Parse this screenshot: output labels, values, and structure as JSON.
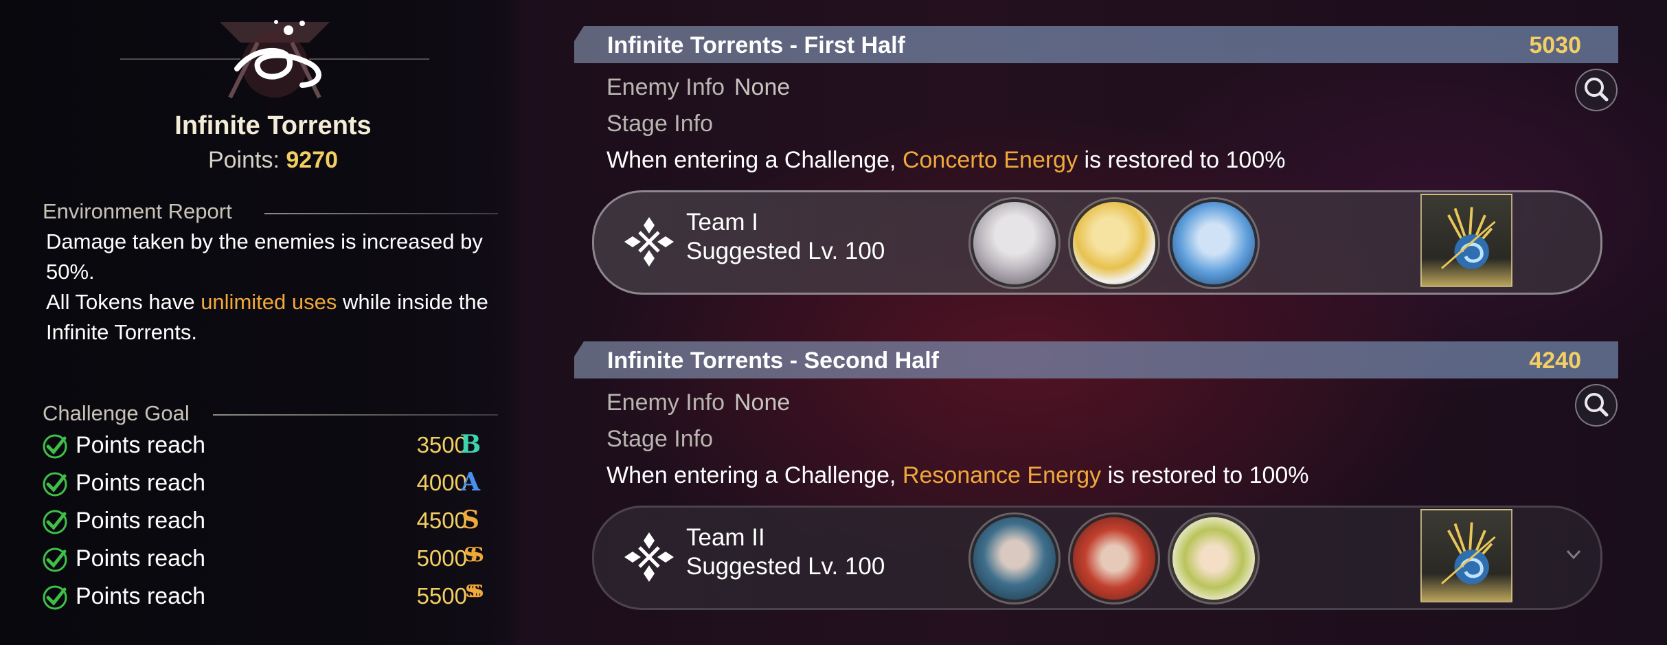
{
  "left": {
    "stage_name": "Infinite Torrents",
    "points_label": "Points:",
    "points_value": "9270",
    "environment": {
      "title": "Environment Report",
      "line1": "Damage taken by the enemies is increased by 50%.",
      "line2_pre": "All Tokens have ",
      "line2_highlight": "unlimited uses",
      "line2_post": " while inside the Infinite Torrents."
    },
    "goals": {
      "title": "Challenge Goal",
      "items": [
        {
          "label": "Points reach",
          "value": "3500",
          "grade": "B",
          "color": "#3fd3b0"
        },
        {
          "label": "Points reach",
          "value": "4000",
          "grade": "A",
          "color": "#4a8ff0"
        },
        {
          "label": "Points reach",
          "value": "4500",
          "grade": "S",
          "color": "#f0a93a"
        },
        {
          "label": "Points reach",
          "value": "5000",
          "grade": "SS",
          "color": "#f0a93a"
        },
        {
          "label": "Points reach",
          "value": "5500",
          "grade": "SSS",
          "color": "#f0a93a"
        }
      ]
    }
  },
  "stages": [
    {
      "title": "Infinite Torrents - First Half",
      "score": "5030",
      "enemy_label": "Enemy Info",
      "enemy_value": "None",
      "stage_info_label": "Stage Info",
      "desc_pre": "When entering a Challenge, ",
      "desc_highlight": "Concerto Energy",
      "desc_post": " is restored to 100%",
      "team_name": "Team I",
      "team_level": "Suggested Lv. 100"
    },
    {
      "title": "Infinite Torrents - Second Half",
      "score": "4240",
      "enemy_label": "Enemy Info",
      "enemy_value": "None",
      "stage_info_label": "Stage Info",
      "desc_pre": "When entering a Challenge, ",
      "desc_highlight": "Resonance Energy",
      "desc_post": " is restored to 100%",
      "team_name": "Team II",
      "team_level": "Suggested Lv. 100"
    }
  ],
  "colors": {
    "accent_gold": "#f3cf63",
    "highlight_orange": "#f0a93a",
    "check_green": "#3fbf4a"
  }
}
